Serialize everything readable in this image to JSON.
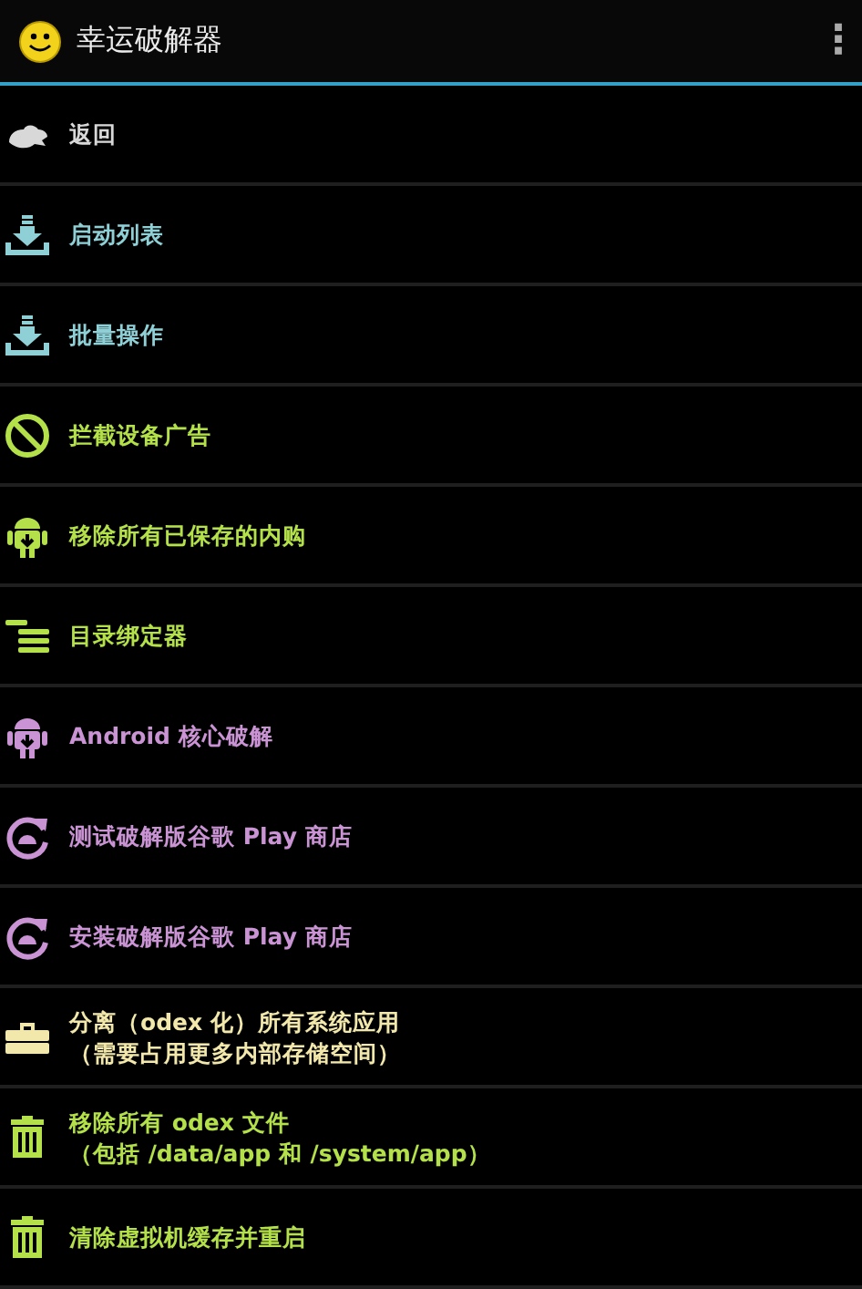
{
  "action_bar": {
    "title": "幸运破解器",
    "overflow": "⋮"
  },
  "menu": [
    {
      "kind": "back",
      "color": "#d8d8d8",
      "lines": [
        "返回"
      ]
    },
    {
      "kind": "download",
      "color": "#8fd0d6",
      "lines": [
        "启动列表"
      ]
    },
    {
      "kind": "download",
      "color": "#8fd0d6",
      "lines": [
        "批量操作"
      ]
    },
    {
      "kind": "noads",
      "color": "#b4e14a",
      "lines": [
        "拦截设备广告"
      ]
    },
    {
      "kind": "android",
      "color": "#b4e14a",
      "lines": [
        "移除所有已保存的内购"
      ]
    },
    {
      "kind": "list",
      "color": "#b4e14a",
      "lines": [
        "目录绑定器"
      ]
    },
    {
      "kind": "android",
      "color": "#c993d4",
      "lines": [
        "Android 核心破解"
      ]
    },
    {
      "kind": "sync",
      "color": "#c993d4",
      "lines": [
        "测试破解版谷歌 Play 商店"
      ]
    },
    {
      "kind": "sync",
      "color": "#c993d4",
      "lines": [
        "安装破解版谷歌 Play 商店"
      ]
    },
    {
      "kind": "toolbox",
      "color": "#f2e8ab",
      "lines": [
        "分离（odex 化）所有系统应用",
        "（需要占用更多内部存储空间）"
      ]
    },
    {
      "kind": "trash",
      "color": "#b4e14a",
      "lines": [
        "移除所有 odex 文件",
        "（包括 /data/app 和 /system/app）"
      ]
    },
    {
      "kind": "trash",
      "color": "#b4e14a",
      "lines": [
        "清除虚拟机缓存并重启"
      ]
    }
  ]
}
